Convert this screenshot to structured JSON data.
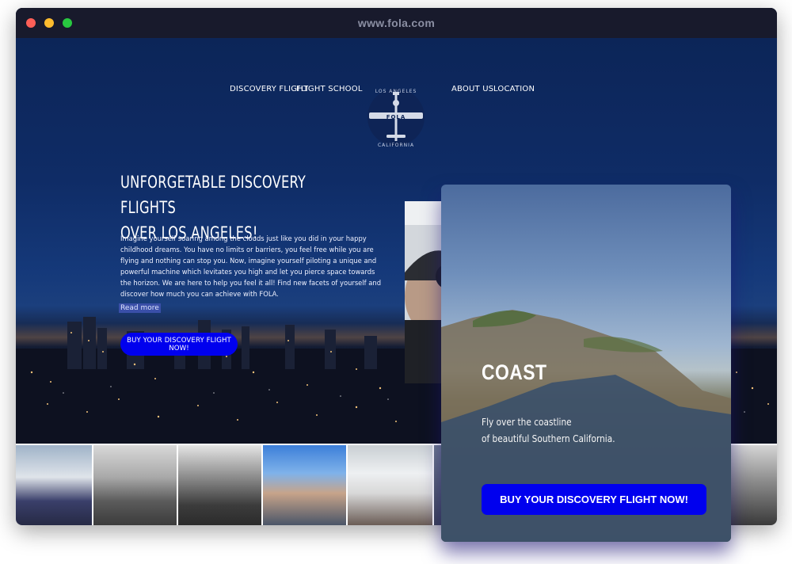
{
  "browser": {
    "url": "www.fola.com"
  },
  "nav": {
    "discovery_flight": "DISCOVERY FLIGHT",
    "flight_school": "FLIGHT SCHOOL",
    "about_us": "ABOUT US",
    "location": "LOCATION"
  },
  "logo": {
    "top_text": "LOS ANGELES",
    "wing_text": "FOLA",
    "bottom_text": "CALIFORNIA"
  },
  "hero": {
    "title_line1": "UNFORGETABLE DISCOVERY FLIGHTS",
    "title_line2": "OVER LOS ANGELES!",
    "paragraph": "Imagine yourself soaring among the clouds just like you did in your happy childhood dreams. You have no limits or barriers, you feel free while you are flying and nothing can stop you. Now, imagine yourself piloting a unique and powerful machine which levitates you high and let you pierce space towards the horizon. We are here to help you feel it all! Find new facets of yourself and discover how much you can achieve with FOLA.",
    "read_more": "Read more",
    "cta": "BUY YOUR DISCOVERY FLIGHT NOW!"
  },
  "card": {
    "title": "COAST",
    "line1": "Fly over the coastline",
    "line2": "of beautiful Southern California.",
    "cta": "BUY YOUR DISCOVERY FLIGHT NOW!"
  },
  "colors": {
    "accent": "#0000ee",
    "hero_bg": "#0c2558",
    "titlebar": "#181a2c"
  }
}
